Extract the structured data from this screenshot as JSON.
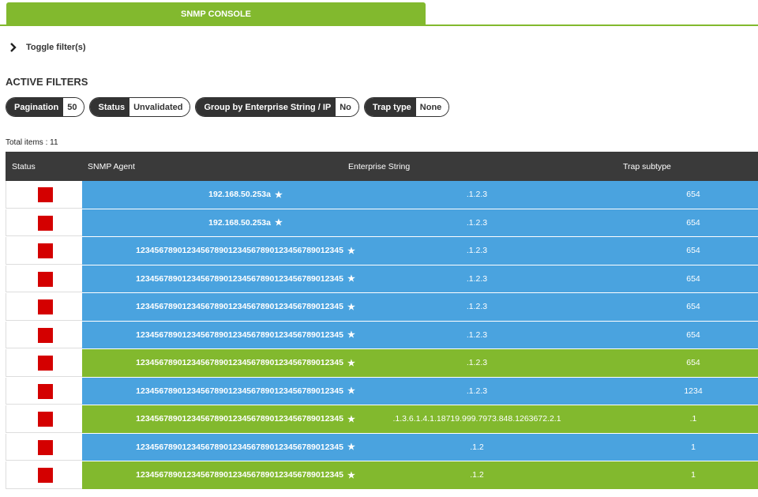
{
  "tabs": {
    "active_label": "SNMP CONSOLE"
  },
  "toggle": {
    "label": "Toggle filter(s)"
  },
  "section_title": "ACTIVE FILTERS",
  "filters": [
    {
      "key": "Pagination",
      "value": "50"
    },
    {
      "key": "Status",
      "value": "Unvalidated"
    },
    {
      "key": "Group by Enterprise String / IP",
      "value": "No"
    },
    {
      "key": "Trap type",
      "value": "None"
    }
  ],
  "total_items": "Total items : 11",
  "table": {
    "columns": [
      "Status",
      "SNMP Agent",
      "Enterprise String",
      "Trap subtype"
    ],
    "rows": [
      {
        "color": "blue",
        "agent": "192.168.50.253a",
        "enterprise": ".1.2.3",
        "subtype": "654"
      },
      {
        "color": "blue",
        "agent": "192.168.50.253a",
        "enterprise": ".1.2.3",
        "subtype": "654"
      },
      {
        "color": "blue",
        "agent": "12345678901234567890123456789012345678901234​5",
        "enterprise": ".1.2.3",
        "subtype": "654"
      },
      {
        "color": "blue",
        "agent": "123456789012345678901234567890123456789012345",
        "enterprise": ".1.2.3",
        "subtype": "654"
      },
      {
        "color": "blue",
        "agent": "123456789012345678901234567890123456789012345",
        "enterprise": ".1.2.3",
        "subtype": "654"
      },
      {
        "color": "blue",
        "agent": "123456789012345678901234567890123456789012345",
        "enterprise": ".1.2.3",
        "subtype": "654"
      },
      {
        "color": "green",
        "agent": "123456789012345678901234567890123456789012345",
        "enterprise": ".1.2.3",
        "subtype": "654"
      },
      {
        "color": "blue",
        "agent": "123456789012345678901234567890123456789012345",
        "enterprise": ".1.2.3",
        "subtype": "1234"
      },
      {
        "color": "green",
        "agent": "123456789012345678901234567890123456789012345",
        "enterprise": ".1.3.6.1.4.1.18719.999.7973.848.1263672.2.1",
        "subtype": ".1"
      },
      {
        "color": "blue",
        "agent": "123456789012345678901234567890123456789012345",
        "enterprise": ".1.2",
        "subtype": "1"
      },
      {
        "color": "green",
        "agent": "123456789012345678901234567890123456789012345",
        "enterprise": ".1.2",
        "subtype": "1"
      }
    ]
  },
  "colors": {
    "green": "#82b92e",
    "blue": "#4aa3df",
    "status_red": "#d40000",
    "header_dark": "#3a3a3a"
  },
  "icons": {
    "toggle": "chevron-right-icon",
    "status": "status-square-icon",
    "agent": "star-icon"
  }
}
